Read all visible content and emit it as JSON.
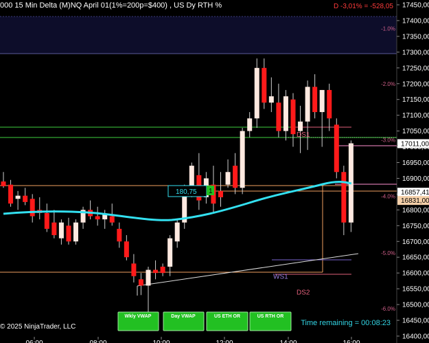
{
  "header": {
    "title": "000 15 Min Delta (M)NQ  April 01(1%=200p=$400) , US Dy RTH %",
    "daily_change": "D -3,01% = -528,05"
  },
  "footer": {
    "copyright": "© 2025 NinjaTrader, LLC",
    "time_remaining": "Time remaining = 00:08:23"
  },
  "buttons": [
    {
      "label": "Wkly VWAP"
    },
    {
      "label": "Day VWAP"
    },
    {
      "label": "US ETH OR"
    },
    {
      "label": "US RTH OR"
    }
  ],
  "x_ticks": [
    "06:00",
    "08:00",
    "10:00",
    "12:00",
    "14:00",
    "16:00"
  ],
  "price_ticks": [
    "17450,00",
    "17400,00",
    "17350,00",
    "17300,00",
    "17250,00",
    "17200,00",
    "17150,00",
    "17100,00",
    "17050,00",
    "17000,00",
    "16950,00",
    "16900,00",
    "16850,00",
    "16800,00",
    "16750,00",
    "16700,00",
    "16650,00",
    "16600,00",
    "16550,00",
    "16500,00",
    "16450,00",
    "16400,00"
  ],
  "price_tick_values": [
    17450,
    17400,
    17350,
    17300,
    17250,
    17200,
    17150,
    17100,
    17050,
    17000,
    16950,
    16900,
    16850,
    16800,
    16750,
    16700,
    16650,
    16600,
    16550,
    16500,
    16450,
    16400
  ],
  "pct_levels": [
    {
      "label": "-1.0%",
      "price": 17375
    },
    {
      "label": "-2.0%",
      "price": 17200
    },
    {
      "label": "-3.0%",
      "price": 17022
    },
    {
      "label": "-4.0%",
      "price": 16843
    },
    {
      "label": "-5.0%",
      "price": 16663
    },
    {
      "label": "-6.0%",
      "price": 16487
    }
  ],
  "price_flags": [
    {
      "label": "17011,00",
      "price": 17011,
      "bg": "#ffffff",
      "fg": "#000000"
    },
    {
      "label": "16857,41",
      "price": 16857,
      "bg": "#ffffff",
      "fg": "#000000"
    },
    {
      "label": "16831,00",
      "price": 16831,
      "bg": "#f5d0a9",
      "fg": "#000000"
    }
  ],
  "level_labels": [
    {
      "label": "DS1",
      "price": 17040,
      "color": "#e0607a"
    },
    {
      "label": "WS1",
      "price": 16590,
      "color": "#9a7fe0"
    },
    {
      "label": "DS2",
      "price": 16540,
      "color": "#e0607a"
    }
  ],
  "box_label": {
    "value": "180,75",
    "count": "1"
  },
  "colors": {
    "bull": "#ffe9e0",
    "bear": "#ff1a1a",
    "vwap": "#33e0f0",
    "orange": "#f0a060",
    "green": "#3ecf3e",
    "button_green": "#22c022"
  },
  "chart_data": {
    "type": "candlestick",
    "y_range": [
      16380,
      17470
    ],
    "x_tick_labels": [
      "06:00",
      "08:00",
      "10:00",
      "12:00",
      "14:00",
      "16:00"
    ],
    "candles": [
      {
        "o": 16890,
        "h": 16920,
        "l": 16870,
        "c": 16875
      },
      {
        "o": 16880,
        "h": 16895,
        "l": 16810,
        "c": 16820
      },
      {
        "o": 16835,
        "h": 16860,
        "l": 16800,
        "c": 16845
      },
      {
        "o": 16845,
        "h": 16870,
        "l": 16815,
        "c": 16825
      },
      {
        "o": 16835,
        "h": 16850,
        "l": 16760,
        "c": 16780
      },
      {
        "o": 16800,
        "h": 16840,
        "l": 16770,
        "c": 16790
      },
      {
        "o": 16790,
        "h": 16820,
        "l": 16730,
        "c": 16740
      },
      {
        "o": 16760,
        "h": 16800,
        "l": 16710,
        "c": 16720
      },
      {
        "o": 16710,
        "h": 16770,
        "l": 16690,
        "c": 16760
      },
      {
        "o": 16750,
        "h": 16775,
        "l": 16690,
        "c": 16700
      },
      {
        "o": 16700,
        "h": 16770,
        "l": 16690,
        "c": 16760
      },
      {
        "o": 16760,
        "h": 16810,
        "l": 16740,
        "c": 16800
      },
      {
        "o": 16800,
        "h": 16830,
        "l": 16770,
        "c": 16780
      },
      {
        "o": 16780,
        "h": 16810,
        "l": 16750,
        "c": 16770
      },
      {
        "o": 16770,
        "h": 16800,
        "l": 16740,
        "c": 16785
      },
      {
        "o": 16780,
        "h": 16820,
        "l": 16750,
        "c": 16760
      },
      {
        "o": 16740,
        "h": 16760,
        "l": 16680,
        "c": 16700
      },
      {
        "o": 16700,
        "h": 16720,
        "l": 16640,
        "c": 16650
      },
      {
        "o": 16630,
        "h": 16660,
        "l": 16570,
        "c": 16590
      },
      {
        "o": 16580,
        "h": 16600,
        "l": 16530,
        "c": 16560
      },
      {
        "o": 16560,
        "h": 16620,
        "l": 16470,
        "c": 16610
      },
      {
        "o": 16610,
        "h": 16640,
        "l": 16580,
        "c": 16600
      },
      {
        "o": 16620,
        "h": 16630,
        "l": 16590,
        "c": 16600
      },
      {
        "o": 16620,
        "h": 16720,
        "l": 16590,
        "c": 16710
      },
      {
        "o": 16700,
        "h": 16770,
        "l": 16680,
        "c": 16760
      },
      {
        "o": 16760,
        "h": 16880,
        "l": 16740,
        "c": 16870
      },
      {
        "o": 16860,
        "h": 16950,
        "l": 16840,
        "c": 16940
      },
      {
        "o": 16910,
        "h": 16980,
        "l": 16800,
        "c": 16830
      },
      {
        "o": 16840,
        "h": 16920,
        "l": 16820,
        "c": 16900
      },
      {
        "o": 16880,
        "h": 16940,
        "l": 16790,
        "c": 16820
      },
      {
        "o": 16860,
        "h": 16920,
        "l": 16810,
        "c": 16840
      },
      {
        "o": 16880,
        "h": 16960,
        "l": 16870,
        "c": 16920
      },
      {
        "o": 16940,
        "h": 16980,
        "l": 16850,
        "c": 16870
      },
      {
        "o": 16870,
        "h": 17060,
        "l": 16850,
        "c": 17050
      },
      {
        "o": 17050,
        "h": 17110,
        "l": 17030,
        "c": 17090
      },
      {
        "o": 17090,
        "h": 17280,
        "l": 17060,
        "c": 17250
      },
      {
        "o": 17250,
        "h": 17280,
        "l": 17120,
        "c": 17140
      },
      {
        "o": 17140,
        "h": 17220,
        "l": 17110,
        "c": 17160
      },
      {
        "o": 17140,
        "h": 17200,
        "l": 17030,
        "c": 17050
      },
      {
        "o": 17050,
        "h": 17180,
        "l": 17020,
        "c": 17160
      },
      {
        "o": 17150,
        "h": 17170,
        "l": 17000,
        "c": 17040
      },
      {
        "o": 17050,
        "h": 17130,
        "l": 16980,
        "c": 17080
      },
      {
        "o": 17080,
        "h": 17210,
        "l": 16990,
        "c": 17190
      },
      {
        "o": 17190,
        "h": 17230,
        "l": 17090,
        "c": 17110
      },
      {
        "o": 17110,
        "h": 17180,
        "l": 17000,
        "c": 17180
      },
      {
        "o": 17180,
        "h": 17200,
        "l": 17050,
        "c": 17090
      },
      {
        "o": 17070,
        "h": 17090,
        "l": 16900,
        "c": 16920
      },
      {
        "o": 16920,
        "h": 16940,
        "l": 16720,
        "c": 16760
      },
      {
        "o": 16760,
        "h": 17020,
        "l": 16730,
        "c": 17011
      }
    ]
  }
}
